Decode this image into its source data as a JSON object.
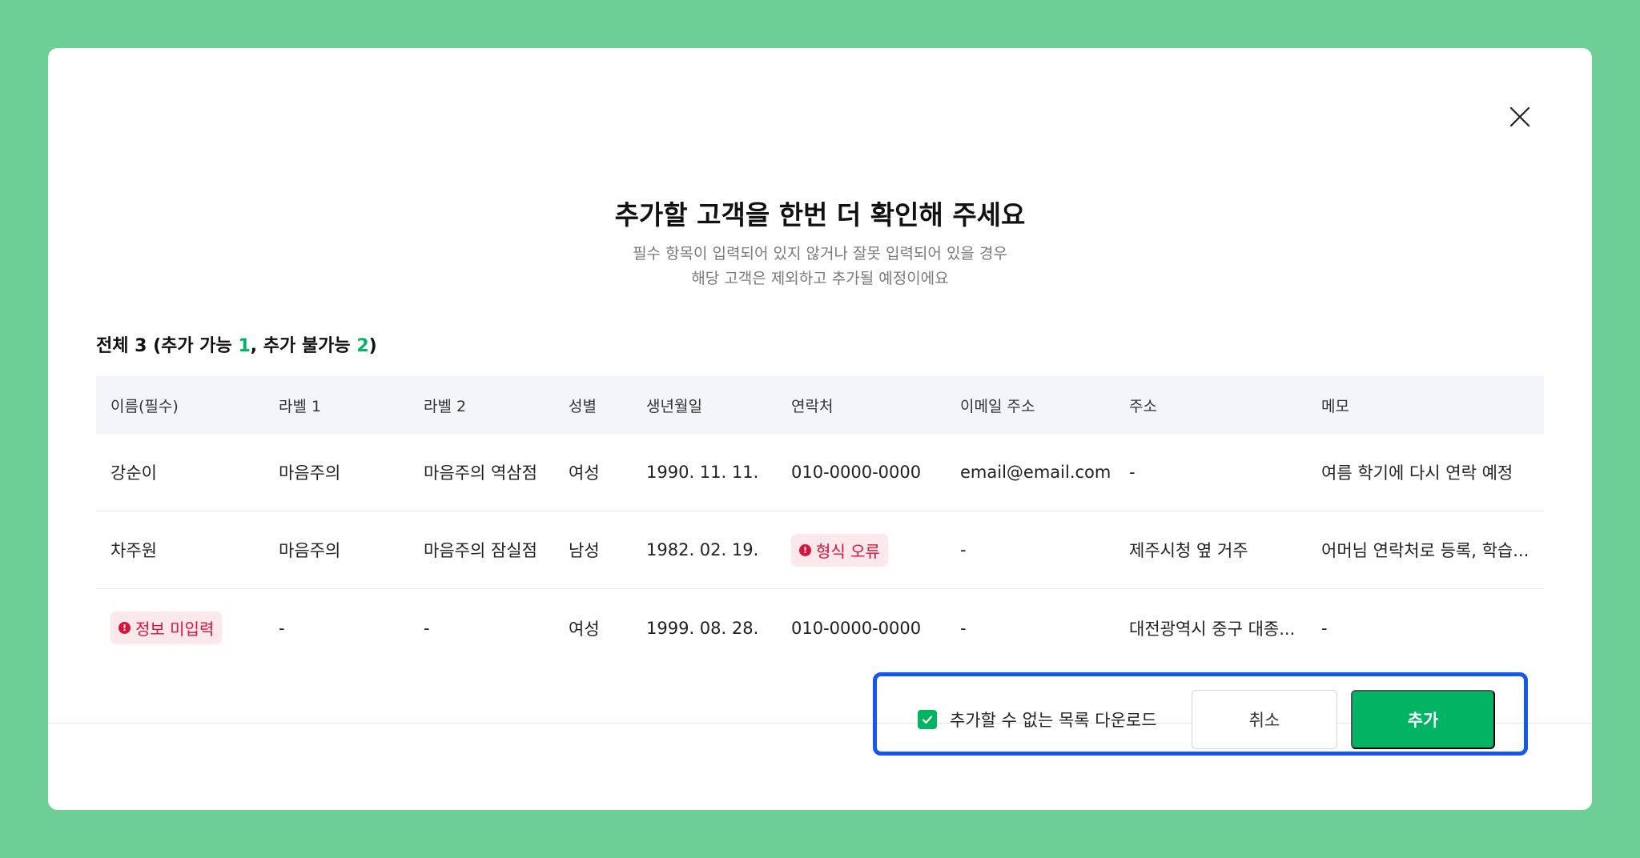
{
  "modal": {
    "title": "추가할 고객을 한번 더 확인해 주세요",
    "subtitle_line1": "필수 항목이 입력되어 있지 않거나 잘못 입력되어 있을 경우",
    "subtitle_line2": "해당 고객은 제외하고 추가될 예정이에요"
  },
  "summary": {
    "prefix": "전체 3 (추가 가능 ",
    "possible": "1",
    "middle": ", 추가 불가능 ",
    "impossible": "2",
    "suffix": ")"
  },
  "table": {
    "headers": [
      "이름(필수)",
      "라벨 1",
      "라벨 2",
      "성별",
      "생년월일",
      "연락처",
      "이메일 주소",
      "주소",
      "메모"
    ],
    "rows": [
      [
        "강순이",
        "마음주의",
        "마음주의 역삼점",
        "여성",
        "1990. 11. 11.",
        "010-0000-0000",
        "email@email.com",
        "-",
        "여름 학기에 다시 연락 예정"
      ],
      [
        "차주원",
        "마음주의",
        "마음주의 잠실점",
        "남성",
        "1982. 02. 19.",
        "형식 오류",
        "-",
        "제주시청 옆 거주",
        "어머님 연락처로 등록, 학습..."
      ],
      [
        "정보 미입력",
        "-",
        "-",
        "여성",
        "1999. 08. 28.",
        "010-0000-0000",
        "-",
        "대전광역시 중구 대종...",
        "-"
      ]
    ]
  },
  "footer": {
    "download_label": "추가할 수 없는 목록 다운로드",
    "cancel_label": "취소",
    "add_label": "추가"
  },
  "colors": {
    "background": "#6dcf95",
    "accent": "#00b464",
    "error": "#d9143b",
    "highlight_border": "#1556f5"
  }
}
